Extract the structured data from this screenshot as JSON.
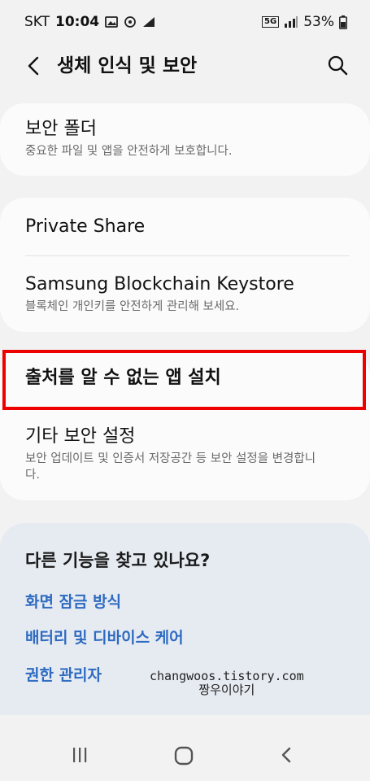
{
  "status": {
    "carrier": "SKT",
    "time": "10:04",
    "network": "5G",
    "battery": "53%"
  },
  "header": {
    "title": "생체 인식 및 보안"
  },
  "items": [
    {
      "title": "보안 폴더",
      "subtitle": "중요한 파일 및 앱을 안전하게 보호합니다."
    },
    {
      "title": "Private Share"
    },
    {
      "title": "Samsung Blockchain Keystore",
      "subtitle": "블록체인 개인키를 안전하게 관리해 보세요."
    },
    {
      "title": "출처를 알 수 없는 앱 설치"
    },
    {
      "title": "기타 보안 설정",
      "subtitle": "보안 업데이트 및 인증서 저장공간 등 보안 설정을 변경합니다."
    }
  ],
  "suggestions": {
    "title": "다른 기능을 찾고 있나요?",
    "links": [
      "화면 잠금 방식",
      "배터리 및 디바이스 케어",
      "권한 관리자"
    ]
  },
  "watermark": {
    "line1": "changwoos.tistory.com",
    "line2": "짱우이야기"
  },
  "colors": {
    "highlight": "#ee0000",
    "link": "#2d6ac0",
    "card": "#fbfbfb",
    "background": "#f2f2f2"
  }
}
